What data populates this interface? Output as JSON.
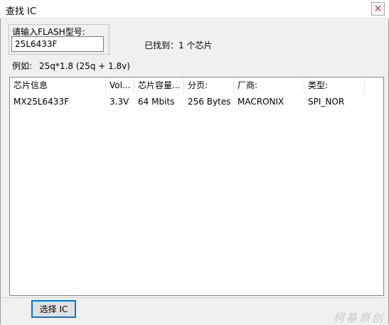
{
  "window": {
    "title": "查找 IC",
    "close_glyph": "×"
  },
  "search": {
    "group_label": "请输入FLASH型号:",
    "value": "25L6433F",
    "found_text": "已找到：1 个芯片",
    "example_label": "例如:",
    "example_value": "25q*1.8 (25q + 1.8v)"
  },
  "table": {
    "columns": [
      "芯片信息",
      "Vol...",
      "芯片容量...",
      "分页:",
      "厂商:",
      "类型:"
    ],
    "rows": [
      [
        "MX25L6433F",
        "3.3V",
        "64 Mbits",
        "256 Bytes",
        "MACRONIX",
        "SPI_NOR"
      ]
    ]
  },
  "footer": {
    "select_button": "选择 IC",
    "watermark": "柯基原创"
  },
  "colors": {
    "accent": "#0078d7",
    "close": "#c42b1c"
  }
}
